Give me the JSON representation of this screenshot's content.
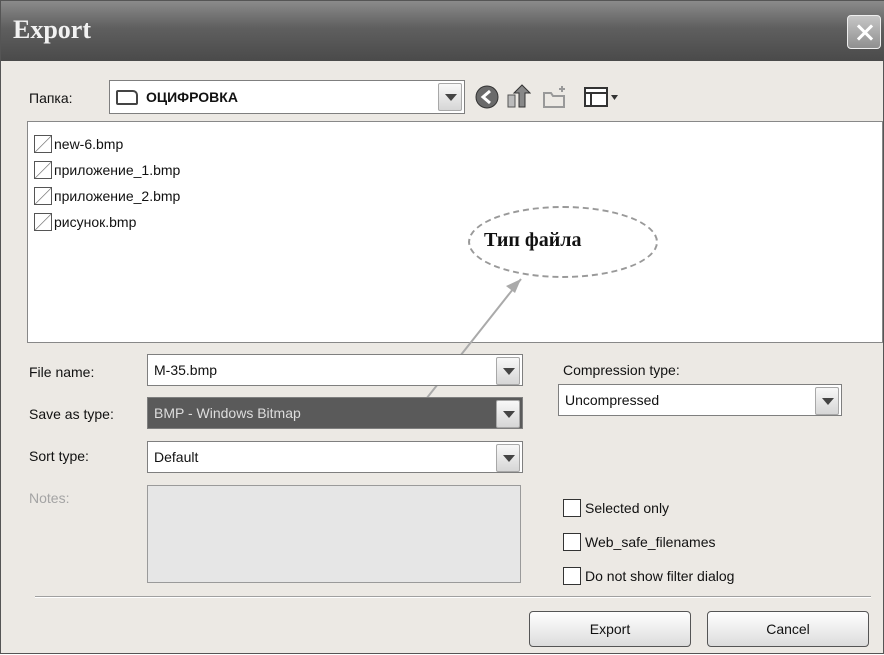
{
  "window": {
    "title": "Export"
  },
  "folder": {
    "label": "Папка:",
    "value": "ОЦИФРОВКА"
  },
  "files": [
    "new-6.bmp",
    "приложение_1.bmp",
    "приложение_2.bmp",
    "рисунок.bmp"
  ],
  "annotation": {
    "text": "Тип файла"
  },
  "form": {
    "file_name_label": "File name:",
    "file_name_value": "M-35.bmp",
    "save_type_label": "Save as type:",
    "save_type_value": "BMP - Windows Bitmap",
    "sort_type_label": "Sort type:",
    "sort_type_value": "Default",
    "notes_label": "Notes:",
    "compression_label": "Compression type:",
    "compression_value": "Uncompressed"
  },
  "options": {
    "selected_only": "Selected only",
    "web_safe": "Web_safe_filenames",
    "no_filter_dialog": "Do not show filter dialog"
  },
  "buttons": {
    "export": "Export",
    "cancel": "Cancel"
  }
}
